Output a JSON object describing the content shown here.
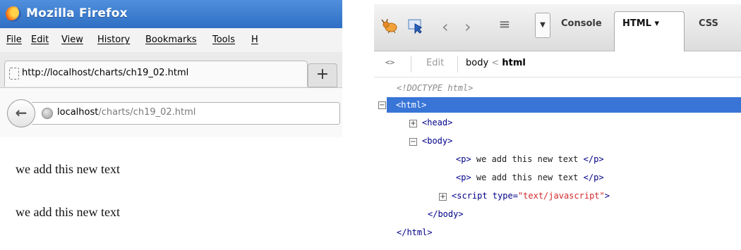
{
  "firefox": {
    "title": "Mozilla Firefox",
    "menu": [
      "File",
      "Edit",
      "View",
      "History",
      "Bookmarks",
      "Tools",
      "H"
    ],
    "tab_title": "http://localhost/charts/ch19_02.html",
    "new_tab_label": "+",
    "url_host": "localhost",
    "url_path": "/charts/ch19_02.html",
    "content": [
      "we add this new text",
      "we add this new text"
    ]
  },
  "firebug": {
    "tabs": {
      "console": "Console",
      "html": "HTML ▾",
      "css": "CSS"
    },
    "edit_label": "Edit",
    "breadcrumb": {
      "body": "body",
      "sep": "<",
      "html": "html"
    },
    "tree": {
      "doctype": "<!DOCTYPE html>",
      "html_open": "<html>",
      "head": "<head>",
      "body_open": "<body>",
      "p_open": "<p>",
      "p_text": " we add this new text ",
      "p_close": "</p>",
      "script_tag_open": "<script",
      "script_attr_name": " type=",
      "script_attr_val": "\"text/javascript\"",
      "script_tag_end": ">",
      "body_close": "</body>",
      "html_close": "</html>"
    }
  },
  "colors": {
    "firefox_title_bar": "#2f6fc4",
    "selected_row": "#3875d7",
    "tag": "#000088",
    "attr_value": "#d32b2b"
  }
}
